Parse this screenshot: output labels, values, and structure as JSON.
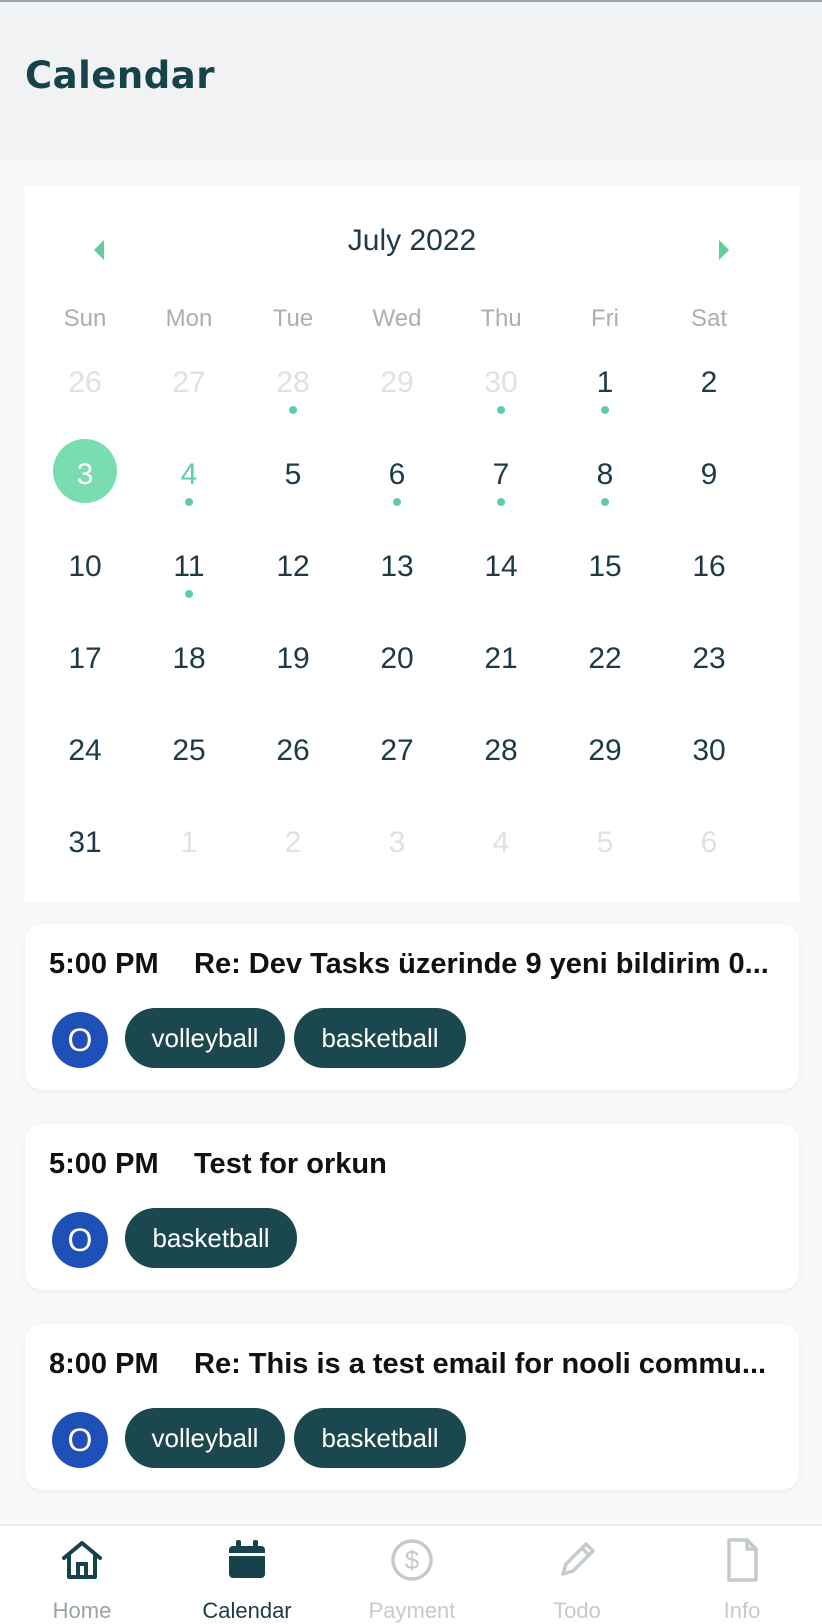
{
  "header": {
    "title": "Calendar"
  },
  "calendar": {
    "month_label": "July 2022",
    "weekdays": [
      "Sun",
      "Mon",
      "Tue",
      "Wed",
      "Thu",
      "Fri",
      "Sat"
    ],
    "accent_color": "#79ddb1",
    "weeks": [
      [
        {
          "d": "26",
          "other": true
        },
        {
          "d": "27",
          "other": true
        },
        {
          "d": "28",
          "other": true,
          "dot": true
        },
        {
          "d": "29",
          "other": true
        },
        {
          "d": "30",
          "other": true,
          "dot": true
        },
        {
          "d": "1",
          "dot": true
        },
        {
          "d": "2"
        }
      ],
      [
        {
          "d": "3",
          "selected": true
        },
        {
          "d": "4",
          "today": true,
          "dot": true
        },
        {
          "d": "5"
        },
        {
          "d": "6",
          "dot": true
        },
        {
          "d": "7",
          "dot": true
        },
        {
          "d": "8",
          "dot": true
        },
        {
          "d": "9"
        }
      ],
      [
        {
          "d": "10"
        },
        {
          "d": "11",
          "dot": true
        },
        {
          "d": "12"
        },
        {
          "d": "13"
        },
        {
          "d": "14"
        },
        {
          "d": "15"
        },
        {
          "d": "16"
        }
      ],
      [
        {
          "d": "17"
        },
        {
          "d": "18"
        },
        {
          "d": "19"
        },
        {
          "d": "20"
        },
        {
          "d": "21"
        },
        {
          "d": "22"
        },
        {
          "d": "23"
        }
      ],
      [
        {
          "d": "24"
        },
        {
          "d": "25"
        },
        {
          "d": "26"
        },
        {
          "d": "27"
        },
        {
          "d": "28"
        },
        {
          "d": "29"
        },
        {
          "d": "30"
        }
      ],
      [
        {
          "d": "31"
        },
        {
          "d": "1",
          "other": true
        },
        {
          "d": "2",
          "other": true
        },
        {
          "d": "3",
          "other": true
        },
        {
          "d": "4",
          "other": true
        },
        {
          "d": "5",
          "other": true
        },
        {
          "d": "6",
          "other": true
        }
      ]
    ]
  },
  "events": [
    {
      "time": "5:00 PM",
      "title": "Re: Dev Tasks üzerinde 9 yeni bildirim 0...",
      "avatar": "O",
      "tags": [
        "volleyball",
        "basketball"
      ]
    },
    {
      "time": "5:00 PM",
      "title": "Test for orkun",
      "avatar": "O",
      "tags": [
        "basketball"
      ]
    },
    {
      "time": "8:00 PM",
      "title": "Re: This is a test email for nooli commu...",
      "avatar": "O",
      "tags": [
        "volleyball",
        "basketball"
      ]
    }
  ],
  "bottom_nav": {
    "items": [
      {
        "label": "Home",
        "icon": "home-icon"
      },
      {
        "label": "Calendar",
        "icon": "calendar-icon",
        "active": true
      },
      {
        "label": "Payment",
        "icon": "dollar-icon"
      },
      {
        "label": "Todo",
        "icon": "pencil-icon"
      },
      {
        "label": "Info",
        "icon": "document-icon"
      }
    ],
    "active_color": "#16424a",
    "inactive_color": "#c4cbcf"
  }
}
